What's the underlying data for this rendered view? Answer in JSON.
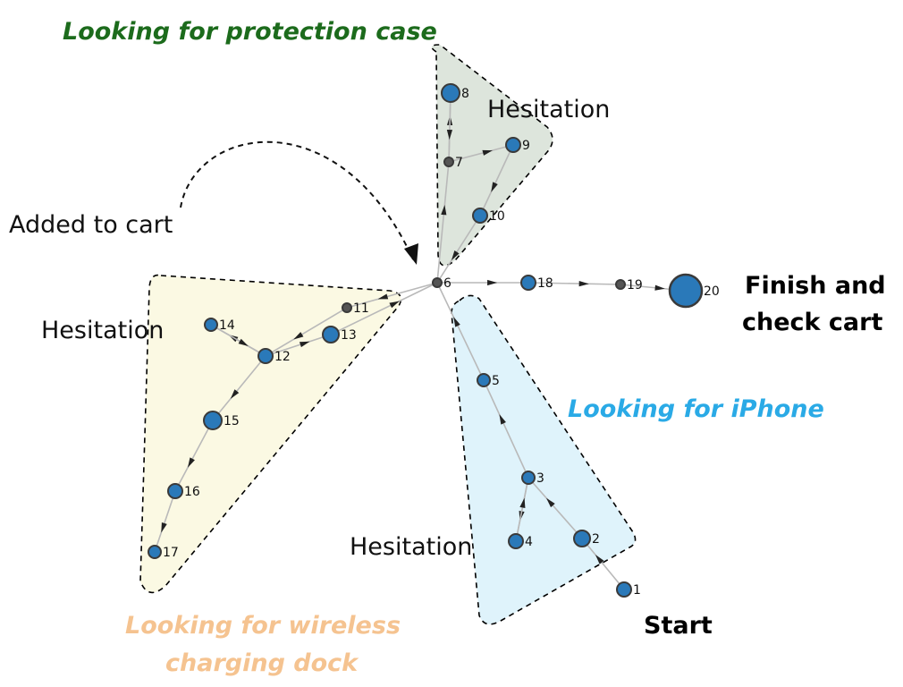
{
  "colors": {
    "node_fill": "#2a79b9",
    "node_stroke": "#3a3a3a",
    "edge": "#b9b9b9",
    "arrow": "#222222",
    "region_green": "#dde5dc",
    "region_yellow": "#fbf9e3",
    "region_blue": "#dff3fb",
    "label_green": "#1c6b1c",
    "label_blue": "#2aaae6",
    "label_orange": "#f5c390"
  },
  "annotations": {
    "protection_case": "Looking for protection case",
    "iphone": "Looking for iPhone",
    "dock_line1": "Looking for wireless",
    "dock_line2": "charging dock",
    "hesitation_top": "Hesitation",
    "hesitation_left": "Hesitation",
    "hesitation_bottom": "Hesitation",
    "added_to_cart": "Added to cart",
    "finish_line1": "Finish and",
    "finish_line2": "check cart",
    "start": "Start"
  },
  "nodes": [
    {
      "id": "1",
      "label": "1"
    },
    {
      "id": "2",
      "label": "2"
    },
    {
      "id": "3",
      "label": "3"
    },
    {
      "id": "4",
      "label": "4"
    },
    {
      "id": "5",
      "label": "5"
    },
    {
      "id": "6",
      "label": "6"
    },
    {
      "id": "7",
      "label": "7"
    },
    {
      "id": "8",
      "label": "8"
    },
    {
      "id": "9",
      "label": "9"
    },
    {
      "id": "10",
      "label": "10"
    },
    {
      "id": "11",
      "label": "11"
    },
    {
      "id": "12",
      "label": "12"
    },
    {
      "id": "13",
      "label": "13"
    },
    {
      "id": "14",
      "label": "14"
    },
    {
      "id": "15",
      "label": "15"
    },
    {
      "id": "16",
      "label": "16"
    },
    {
      "id": "17",
      "label": "17"
    },
    {
      "id": "18",
      "label": "18"
    },
    {
      "id": "19",
      "label": "19"
    },
    {
      "id": "20",
      "label": "20"
    }
  ],
  "edges": [
    [
      "1",
      "2"
    ],
    [
      "2",
      "3"
    ],
    [
      "3",
      "4"
    ],
    [
      "4",
      "3"
    ],
    [
      "3",
      "5"
    ],
    [
      "5",
      "6"
    ],
    [
      "6",
      "7"
    ],
    [
      "7",
      "8"
    ],
    [
      "8",
      "7"
    ],
    [
      "7",
      "9"
    ],
    [
      "9",
      "10"
    ],
    [
      "10",
      "6"
    ],
    [
      "6",
      "11"
    ],
    [
      "11",
      "12"
    ],
    [
      "12",
      "13"
    ],
    [
      "13",
      "6"
    ],
    [
      "12",
      "14"
    ],
    [
      "14",
      "12"
    ],
    [
      "12",
      "15"
    ],
    [
      "15",
      "16"
    ],
    [
      "16",
      "17"
    ],
    [
      "6",
      "18"
    ],
    [
      "18",
      "19"
    ],
    [
      "19",
      "20"
    ]
  ]
}
